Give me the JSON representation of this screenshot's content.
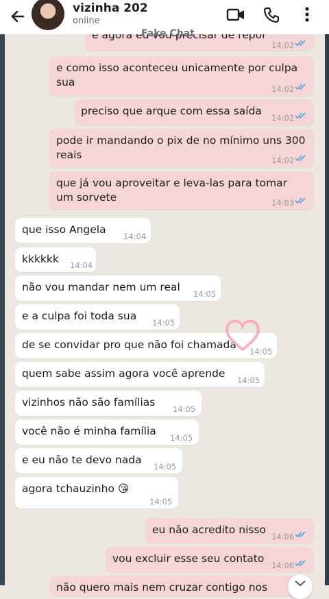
{
  "contact": {
    "name": "vizinha 202",
    "status": "online"
  },
  "watermark": "Fake Chat",
  "icons": {
    "back": "back-arrow-icon",
    "video": "video-call-icon",
    "phone": "phone-call-icon",
    "menu": "more-options-icon",
    "read": "double-check-icon",
    "heart": "heart-sticker-icon",
    "scroll": "chevron-down-icon"
  },
  "colors": {
    "outgoing": "#f6d5d7",
    "incoming": "#ffffff",
    "read_ticks": "#4aa3e0"
  },
  "messages": [
    {
      "dir": "out",
      "text": "e agora eu vou precisar de repor",
      "time": "14:02"
    },
    {
      "dir": "out",
      "text": "e como isso aconteceu unicamente por culpa sua",
      "time": "14:02"
    },
    {
      "dir": "out",
      "text": "preciso que arque com essa saída",
      "time": "14:02"
    },
    {
      "dir": "out",
      "text": "pode ir mandando o pix de no mínimo uns 300 reais",
      "time": "14:02"
    },
    {
      "dir": "out",
      "text": "que já vou aproveitar e leva-las para tomar um sorvete",
      "time": "14:03"
    },
    {
      "dir": "in",
      "text": "que isso Angela",
      "time": "14:04"
    },
    {
      "dir": "in",
      "text": "kkkkkk",
      "time": "14:04"
    },
    {
      "dir": "in",
      "text": "não vou mandar nem um real",
      "time": "14:05"
    },
    {
      "dir": "in",
      "text": "e a culpa foi toda sua",
      "time": "14:05"
    },
    {
      "dir": "in",
      "text": "de se convidar pro que não foi chamada",
      "time": "14:05"
    },
    {
      "dir": "in",
      "text": "quem sabe assim agora você aprende",
      "time": "14:05"
    },
    {
      "dir": "in",
      "text": "vizinhos não são famílias",
      "time": "14:05"
    },
    {
      "dir": "in",
      "text": "você não é minha família",
      "time": "14:05"
    },
    {
      "dir": "in",
      "text": "e eu não te devo nada",
      "time": "14:05"
    },
    {
      "dir": "in",
      "text": "agora tchauzinho 😘",
      "time": "14:05"
    },
    {
      "dir": "out",
      "text": "eu não acredito nisso",
      "time": "14:06"
    },
    {
      "dir": "out",
      "text": "vou excluir esse seu contato",
      "time": "14:06"
    },
    {
      "dir": "out",
      "text": "não quero mais nem cruzar contigo nos",
      "time": ""
    }
  ]
}
